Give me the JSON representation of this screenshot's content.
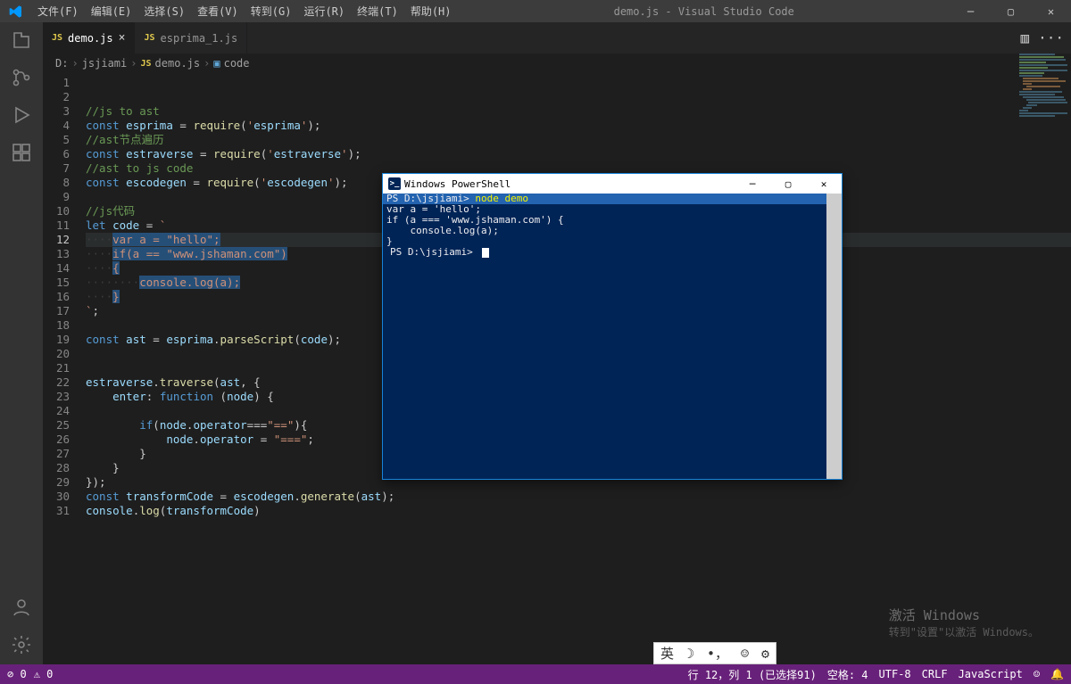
{
  "titlebar": {
    "menus": [
      "文件(F)",
      "编辑(E)",
      "选择(S)",
      "查看(V)",
      "转到(G)",
      "运行(R)",
      "终端(T)",
      "帮助(H)"
    ],
    "title": "demo.js - Visual Studio Code"
  },
  "tabs": [
    {
      "icon": "JS",
      "label": "demo.js",
      "active": true,
      "close": true
    },
    {
      "icon": "JS",
      "label": "esprima_1.js",
      "active": false,
      "close": false
    }
  ],
  "breadcrumb": {
    "drive": "D:",
    "folder": "jsjiami",
    "file": "demo.js",
    "symbol": "code"
  },
  "code": {
    "lines": [
      "",
      "",
      "//js to ast",
      "const esprima = require('esprima');",
      "//ast节点遍历",
      "const estraverse = require('estraverse');",
      "//ast to js code",
      "const escodegen = require('escodegen');",
      "",
      "//js代码",
      "let code = `",
      "····var a = \"hello\";",
      "····if(a == \"www.jshaman.com\")",
      "····{",
      "········console.log(a);",
      "····}",
      "`;",
      "",
      "const ast = esprima.parseScript(code);",
      "",
      "",
      "estraverse.traverse(ast, {",
      "    enter: function (node) {",
      "",
      "        if(node.operator===\"==\"){",
      "            node.operator = \"===\";",
      "        }",
      "    }",
      "});",
      "const transformCode = escodegen.generate(ast);",
      "console.log(transformCode)"
    ],
    "highlightLine": 12
  },
  "powershell": {
    "title": "Windows PowerShell",
    "lines": [
      {
        "text": "PS D:\\jsjiami> node demo",
        "cmd": "node demo",
        "hi": true
      },
      {
        "text": "var a = 'hello';"
      },
      {
        "text": "if (a === 'www.jshaman.com') {"
      },
      {
        "text": "    console.log(a);"
      },
      {
        "text": "}"
      },
      {
        "text": "PS D:\\jsjiami> ",
        "cursor": true
      }
    ]
  },
  "statusbar": {
    "errors": "0",
    "warnings": "0",
    "cursor": "行 12，列 1 (已选择91)",
    "spaces": "空格: 4",
    "encoding": "UTF-8",
    "eol": "CRLF",
    "language": "JavaScript"
  },
  "ime": {
    "lang": "英"
  },
  "activation": {
    "line1": "激活 Windows",
    "line2": "转到\"设置\"以激活 Windows。"
  }
}
